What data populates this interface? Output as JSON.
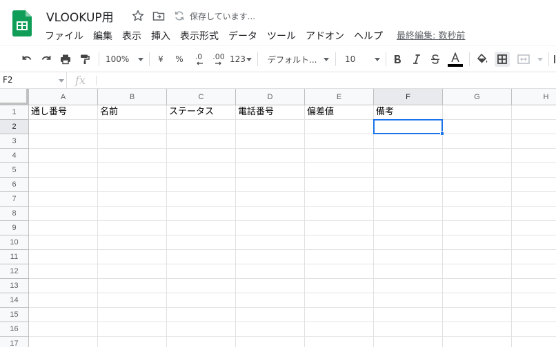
{
  "document": {
    "title": "VLOOKUP用",
    "save_status": "保存しています..."
  },
  "menu": {
    "items": [
      "ファイル",
      "編集",
      "表示",
      "挿入",
      "表示形式",
      "データ",
      "ツール",
      "アドオン",
      "ヘルプ"
    ],
    "last_edit": "最終編集: 数秒前"
  },
  "toolbar": {
    "zoom": "100%",
    "currency": "¥",
    "percent": "%",
    "decrease_decimal": ".0",
    "increase_decimal": ".00",
    "more_formats": "123",
    "font": "デフォルト...",
    "font_size": "10",
    "text_color": "#000000"
  },
  "formula_bar": {
    "cell_ref": "F2",
    "fx": "fx",
    "content": ""
  },
  "sheet": {
    "columns": [
      "A",
      "B",
      "C",
      "D",
      "E",
      "F",
      "G",
      "H"
    ],
    "rows": [
      "1",
      "2",
      "3",
      "4",
      "5",
      "6",
      "7",
      "8",
      "9",
      "10",
      "11",
      "12",
      "13",
      "14",
      "15",
      "16",
      "17"
    ],
    "row1": [
      "通し番号",
      "名前",
      "ステータス",
      "電話番号",
      "偏差値",
      "備考",
      "",
      ""
    ],
    "selected_cell": "F2",
    "selected_col": "F",
    "selected_row": "2"
  },
  "colors": {
    "accent": "#1a73e8",
    "sheets_green": "#0f9d58"
  }
}
